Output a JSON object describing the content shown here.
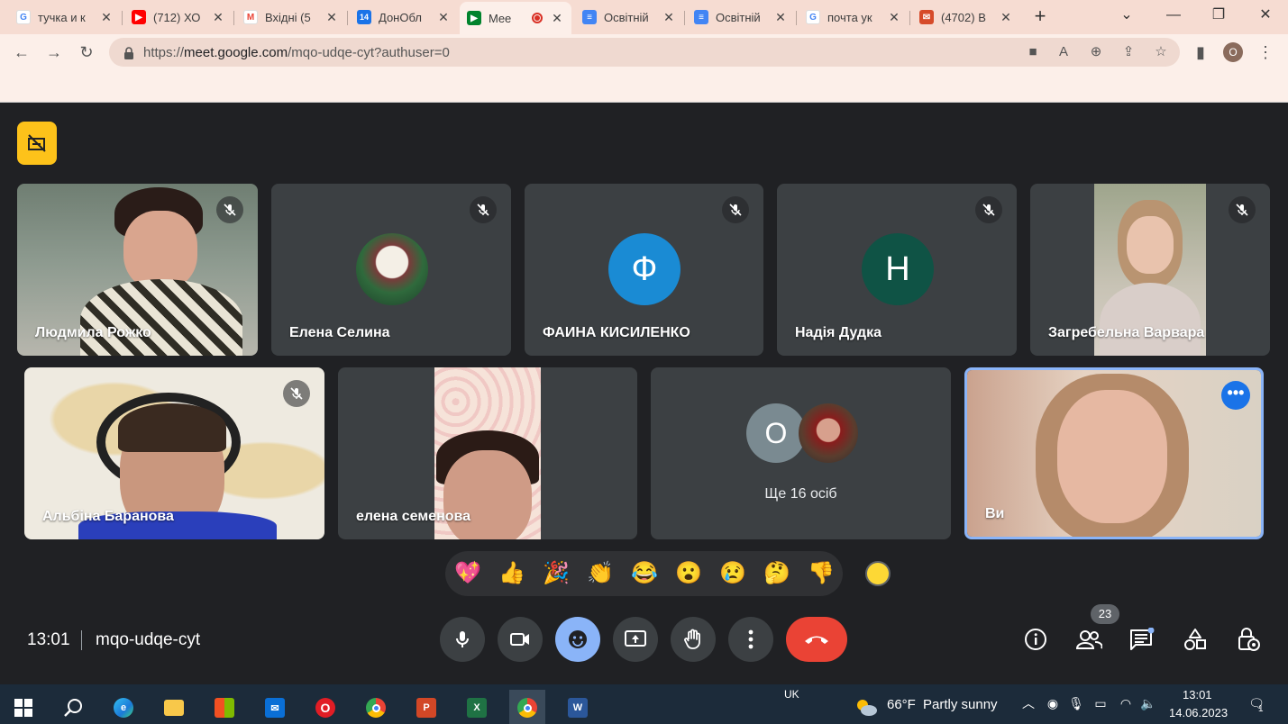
{
  "browser": {
    "tabs": [
      {
        "label": "тучка и к",
        "icon": "google-icon",
        "color": "#4285f4"
      },
      {
        "label": "(712) ХО",
        "icon": "youtube-icon",
        "color": "#ff0000"
      },
      {
        "label": "Вхідні (5",
        "icon": "gmail-icon",
        "color": "#ea4335"
      },
      {
        "label": "ДонОбл",
        "icon": "calendar-icon",
        "color": "#1a73e8"
      },
      {
        "label": "Mee",
        "icon": "meet-icon",
        "color": "#00832d"
      },
      {
        "label": "Освітній",
        "icon": "docs-icon",
        "color": "#4285f4"
      },
      {
        "label": "Освітній",
        "icon": "docs-icon",
        "color": "#4285f4"
      },
      {
        "label": "почта ук",
        "icon": "google-icon",
        "color": "#4285f4"
      },
      {
        "label": "(4702) В",
        "icon": "mail-icon",
        "color": "#d64b2a"
      }
    ],
    "url_prefix": "https://",
    "url_host": "meet.google.com",
    "url_path": "/mqo-udqe-cyt?authuser=0",
    "profile_initial": "O"
  },
  "meet": {
    "participants_row1": [
      {
        "name": "Людмила Рожко",
        "type": "video",
        "muted": true
      },
      {
        "name": "Елена Селина",
        "type": "photo-avatar",
        "muted": true
      },
      {
        "name": "ФАИНА КИСИЛЕНКО",
        "type": "letter",
        "letter": "Ф",
        "color": "#1a8bd4",
        "muted": true
      },
      {
        "name": "Надія Дудка",
        "type": "letter",
        "letter": "Н",
        "color": "#0f5345",
        "muted": true
      },
      {
        "name": "Загребельна Варвара",
        "type": "video",
        "muted": true
      }
    ],
    "participants_row2": [
      {
        "name": "Альбіна Баранова",
        "type": "video",
        "muted": true
      },
      {
        "name": "елена семенова",
        "type": "video",
        "muted": false
      },
      {
        "name": "Ще 16 осіб",
        "type": "others",
        "letter": "О",
        "muted": false
      },
      {
        "name": "Ви",
        "type": "self-video",
        "muted": false
      }
    ],
    "reactions": [
      "💖",
      "👍",
      "🎉",
      "👏",
      "😂",
      "😮",
      "😢",
      "🤔",
      "👎"
    ],
    "time": "13:01",
    "meeting_code": "mqo-udqe-cyt",
    "participant_count": "23"
  },
  "taskbar": {
    "language": "UK",
    "weather_temp": "66°F",
    "weather_text": "Partly sunny",
    "clock_time": "13:01",
    "clock_date": "14.06.2023",
    "notification_count": "1"
  }
}
